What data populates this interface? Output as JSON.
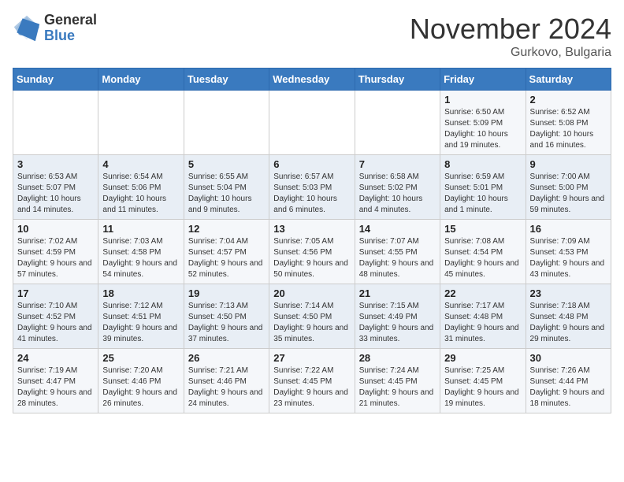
{
  "header": {
    "logo_general": "General",
    "logo_blue": "Blue",
    "month": "November 2024",
    "location": "Gurkovo, Bulgaria"
  },
  "weekdays": [
    "Sunday",
    "Monday",
    "Tuesday",
    "Wednesday",
    "Thursday",
    "Friday",
    "Saturday"
  ],
  "weeks": [
    [
      {
        "day": "",
        "info": ""
      },
      {
        "day": "",
        "info": ""
      },
      {
        "day": "",
        "info": ""
      },
      {
        "day": "",
        "info": ""
      },
      {
        "day": "",
        "info": ""
      },
      {
        "day": "1",
        "info": "Sunrise: 6:50 AM\nSunset: 5:09 PM\nDaylight: 10 hours and 19 minutes."
      },
      {
        "day": "2",
        "info": "Sunrise: 6:52 AM\nSunset: 5:08 PM\nDaylight: 10 hours and 16 minutes."
      }
    ],
    [
      {
        "day": "3",
        "info": "Sunrise: 6:53 AM\nSunset: 5:07 PM\nDaylight: 10 hours and 14 minutes."
      },
      {
        "day": "4",
        "info": "Sunrise: 6:54 AM\nSunset: 5:06 PM\nDaylight: 10 hours and 11 minutes."
      },
      {
        "day": "5",
        "info": "Sunrise: 6:55 AM\nSunset: 5:04 PM\nDaylight: 10 hours and 9 minutes."
      },
      {
        "day": "6",
        "info": "Sunrise: 6:57 AM\nSunset: 5:03 PM\nDaylight: 10 hours and 6 minutes."
      },
      {
        "day": "7",
        "info": "Sunrise: 6:58 AM\nSunset: 5:02 PM\nDaylight: 10 hours and 4 minutes."
      },
      {
        "day": "8",
        "info": "Sunrise: 6:59 AM\nSunset: 5:01 PM\nDaylight: 10 hours and 1 minute."
      },
      {
        "day": "9",
        "info": "Sunrise: 7:00 AM\nSunset: 5:00 PM\nDaylight: 9 hours and 59 minutes."
      }
    ],
    [
      {
        "day": "10",
        "info": "Sunrise: 7:02 AM\nSunset: 4:59 PM\nDaylight: 9 hours and 57 minutes."
      },
      {
        "day": "11",
        "info": "Sunrise: 7:03 AM\nSunset: 4:58 PM\nDaylight: 9 hours and 54 minutes."
      },
      {
        "day": "12",
        "info": "Sunrise: 7:04 AM\nSunset: 4:57 PM\nDaylight: 9 hours and 52 minutes."
      },
      {
        "day": "13",
        "info": "Sunrise: 7:05 AM\nSunset: 4:56 PM\nDaylight: 9 hours and 50 minutes."
      },
      {
        "day": "14",
        "info": "Sunrise: 7:07 AM\nSunset: 4:55 PM\nDaylight: 9 hours and 48 minutes."
      },
      {
        "day": "15",
        "info": "Sunrise: 7:08 AM\nSunset: 4:54 PM\nDaylight: 9 hours and 45 minutes."
      },
      {
        "day": "16",
        "info": "Sunrise: 7:09 AM\nSunset: 4:53 PM\nDaylight: 9 hours and 43 minutes."
      }
    ],
    [
      {
        "day": "17",
        "info": "Sunrise: 7:10 AM\nSunset: 4:52 PM\nDaylight: 9 hours and 41 minutes."
      },
      {
        "day": "18",
        "info": "Sunrise: 7:12 AM\nSunset: 4:51 PM\nDaylight: 9 hours and 39 minutes."
      },
      {
        "day": "19",
        "info": "Sunrise: 7:13 AM\nSunset: 4:50 PM\nDaylight: 9 hours and 37 minutes."
      },
      {
        "day": "20",
        "info": "Sunrise: 7:14 AM\nSunset: 4:50 PM\nDaylight: 9 hours and 35 minutes."
      },
      {
        "day": "21",
        "info": "Sunrise: 7:15 AM\nSunset: 4:49 PM\nDaylight: 9 hours and 33 minutes."
      },
      {
        "day": "22",
        "info": "Sunrise: 7:17 AM\nSunset: 4:48 PM\nDaylight: 9 hours and 31 minutes."
      },
      {
        "day": "23",
        "info": "Sunrise: 7:18 AM\nSunset: 4:48 PM\nDaylight: 9 hours and 29 minutes."
      }
    ],
    [
      {
        "day": "24",
        "info": "Sunrise: 7:19 AM\nSunset: 4:47 PM\nDaylight: 9 hours and 28 minutes."
      },
      {
        "day": "25",
        "info": "Sunrise: 7:20 AM\nSunset: 4:46 PM\nDaylight: 9 hours and 26 minutes."
      },
      {
        "day": "26",
        "info": "Sunrise: 7:21 AM\nSunset: 4:46 PM\nDaylight: 9 hours and 24 minutes."
      },
      {
        "day": "27",
        "info": "Sunrise: 7:22 AM\nSunset: 4:45 PM\nDaylight: 9 hours and 23 minutes."
      },
      {
        "day": "28",
        "info": "Sunrise: 7:24 AM\nSunset: 4:45 PM\nDaylight: 9 hours and 21 minutes."
      },
      {
        "day": "29",
        "info": "Sunrise: 7:25 AM\nSunset: 4:45 PM\nDaylight: 9 hours and 19 minutes."
      },
      {
        "day": "30",
        "info": "Sunrise: 7:26 AM\nSunset: 4:44 PM\nDaylight: 9 hours and 18 minutes."
      }
    ]
  ]
}
